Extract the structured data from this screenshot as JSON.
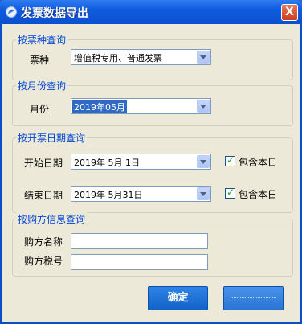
{
  "window": {
    "title": "发票数据导出",
    "close_glyph": "X"
  },
  "groups": {
    "ticket_type": {
      "title": "按票种查询",
      "label": "票种",
      "value": "增值税专用、普通发票"
    },
    "month": {
      "title": "按月份查询",
      "label": "月份",
      "value": "2019年05月"
    },
    "date": {
      "title": "按开票日期查询",
      "start_label": "开始日期",
      "start_value": "2019年  5月  1日",
      "end_label": "结束日期",
      "end_value": "2019年  5月31日",
      "include_start_label": "包含本日",
      "include_end_label": "包含本日",
      "include_start_checked": true,
      "include_end_checked": true
    },
    "buyer": {
      "title": "按购方信息查询",
      "name_label": "购方名称",
      "tax_label": "购方税号",
      "name_value": "",
      "tax_value": ""
    }
  },
  "buttons": {
    "confirm": "确定",
    "second": ""
  },
  "colors": {
    "titlebar": "#0a50cf",
    "group_title": "#0046d5",
    "dialog_bg": "#ece9d8",
    "checkmark": "#21a121",
    "selection": "#316ac5"
  },
  "icons": {
    "app": "app-icon",
    "close": "close-icon",
    "dropdown": "chevron-down-icon",
    "check": "check-icon"
  }
}
